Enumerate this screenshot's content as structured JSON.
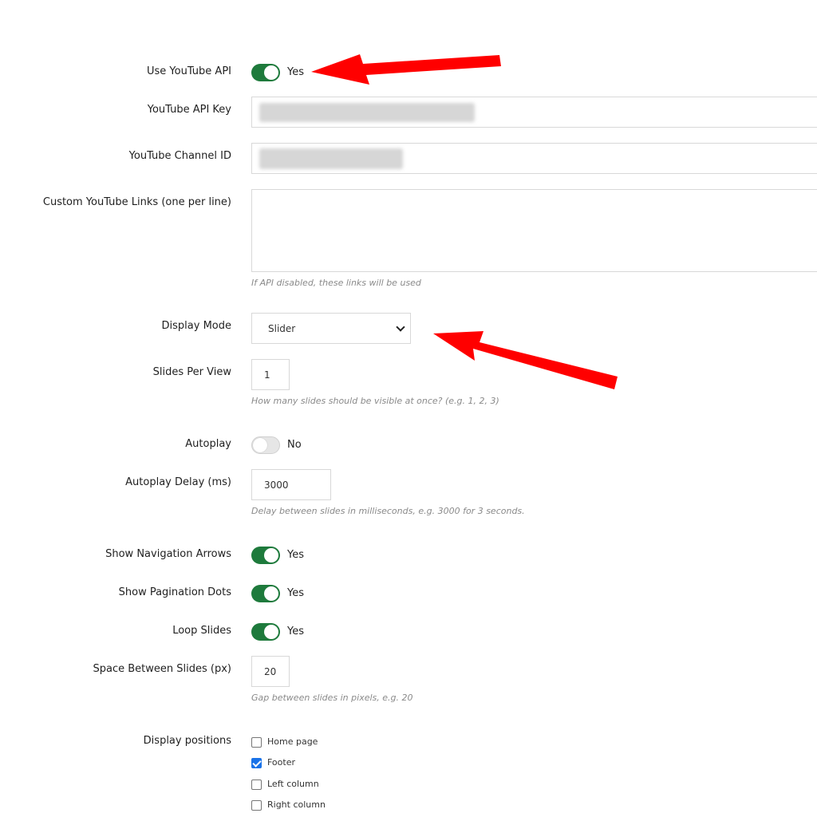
{
  "settings": {
    "use_youtube_api": {
      "label": "Use YouTube API",
      "state": "Yes"
    },
    "api_key": {
      "label": "YouTube API Key"
    },
    "channel_id": {
      "label": "YouTube Channel ID"
    },
    "custom_links": {
      "label": "Custom YouTube Links (one per line)",
      "help": "If API disabled, these links will be used"
    },
    "display_mode": {
      "label": "Display Mode",
      "value": "Slider"
    },
    "slides_per_view": {
      "label": "Slides Per View",
      "value": "1",
      "help": "How many slides should be visible at once? (e.g. 1, 2, 3)"
    },
    "autoplay": {
      "label": "Autoplay",
      "state": "No"
    },
    "autoplay_delay": {
      "label": "Autoplay Delay (ms)",
      "value": "3000",
      "help": "Delay between slides in milliseconds, e.g. 3000 for 3 seconds."
    },
    "nav_arrows": {
      "label": "Show Navigation Arrows",
      "state": "Yes"
    },
    "pagination_dots": {
      "label": "Show Pagination Dots",
      "state": "Yes"
    },
    "loop_slides": {
      "label": "Loop Slides",
      "state": "Yes"
    },
    "space_between": {
      "label": "Space Between Slides (px)",
      "value": "20",
      "help": "Gap between slides in pixels, e.g. 20"
    },
    "display_positions": {
      "label": "Display positions",
      "options": [
        {
          "label": "Home page",
          "checked": false
        },
        {
          "label": "Footer",
          "checked": true
        },
        {
          "label": "Left column",
          "checked": false
        },
        {
          "label": "Right column",
          "checked": false
        }
      ]
    }
  },
  "colors": {
    "toggle_on": "#1e7a3c",
    "annotation_arrow": "#ff0000",
    "checkbox_checked": "#1a73e8"
  }
}
